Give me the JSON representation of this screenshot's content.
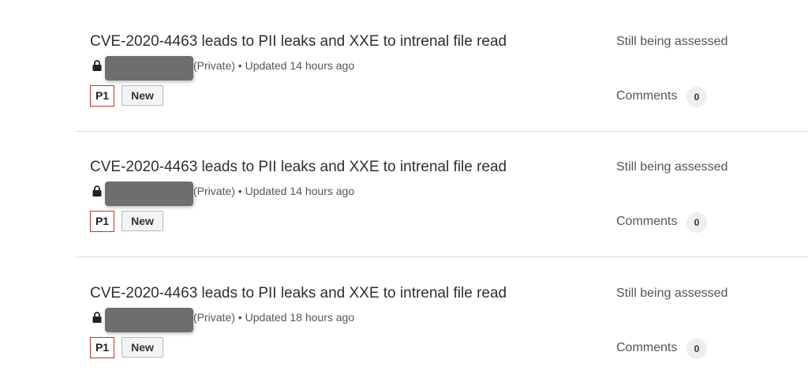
{
  "reports": [
    {
      "title": "CVE-2020-4463 leads to PII leaks and XXE to intrenal file read",
      "meta": "(Private) • Updated 14 hours ago",
      "priority": "P1",
      "state": "New",
      "status": "Still being assessed",
      "comments_label": "Comments",
      "comments_count": "0"
    },
    {
      "title": "CVE-2020-4463 leads to PII leaks and XXE to intrenal file read",
      "meta": "(Private) • Updated 14 hours ago",
      "priority": "P1",
      "state": "New",
      "status": "Still being assessed",
      "comments_label": "Comments",
      "comments_count": "0"
    },
    {
      "title": "CVE-2020-4463 leads to PII leaks and XXE to intrenal file read",
      "meta": "(Private) • Updated 18 hours ago",
      "priority": "P1",
      "state": "New",
      "status": "Still being assessed",
      "comments_label": "Comments",
      "comments_count": "0"
    }
  ],
  "icons": {
    "lock": "lock-icon"
  },
  "colors": {
    "priority_border": "#c0392b",
    "redaction": "#6e6e6e",
    "divider": "#dddddd"
  }
}
